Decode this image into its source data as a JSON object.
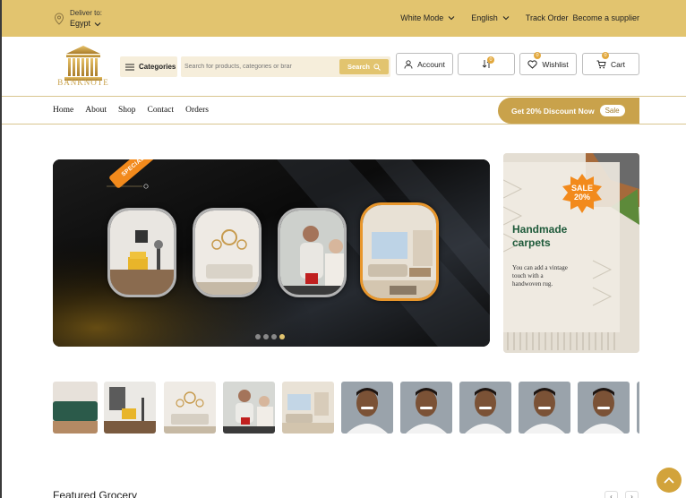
{
  "topbar": {
    "deliver_label": "Deliver to:",
    "deliver_value": "Egypt",
    "mode_label": "White Mode",
    "language_label": "English",
    "track_order": "Track Order",
    "become_supplier": "Become a supplier"
  },
  "header": {
    "logo_text": "BANKNOTE",
    "categories_label": "Categories",
    "search_placeholder": "Search for products, categories or brar",
    "search_button": "Search",
    "account_label": "Account",
    "compare_count": "0",
    "wishlist_count": "0",
    "wishlist_label": "Wishlist",
    "cart_count": "0",
    "cart_label": "Cart"
  },
  "nav": {
    "links": [
      "Home",
      "About",
      "Shop",
      "Contact",
      "Orders"
    ],
    "discount_text": "Get 20% Discount Now",
    "discount_badge": "Sale"
  },
  "hero": {
    "ribbon": "SPECIAL OFFER",
    "slide_count": 4,
    "active_slide": 4
  },
  "side_banner": {
    "badge": "SALE\n20%",
    "title": "Handmade\ncarpets",
    "subtitle": "You can add a vintage\ntouch with a\nhandwoven rug."
  },
  "thumbnails": [
    "sofa",
    "armchair",
    "living-room",
    "people-cooking",
    "interior",
    "portrait",
    "portrait",
    "portrait",
    "portrait",
    "portrait",
    "portrait"
  ],
  "featured": {
    "title": "Featured Grocery",
    "prev": "‹",
    "next": "›"
  },
  "colors": {
    "gold": "#e2c46f",
    "gold_dark": "#c9a24b",
    "orange": "#f28a1c",
    "green_text": "#1e5a3a"
  }
}
